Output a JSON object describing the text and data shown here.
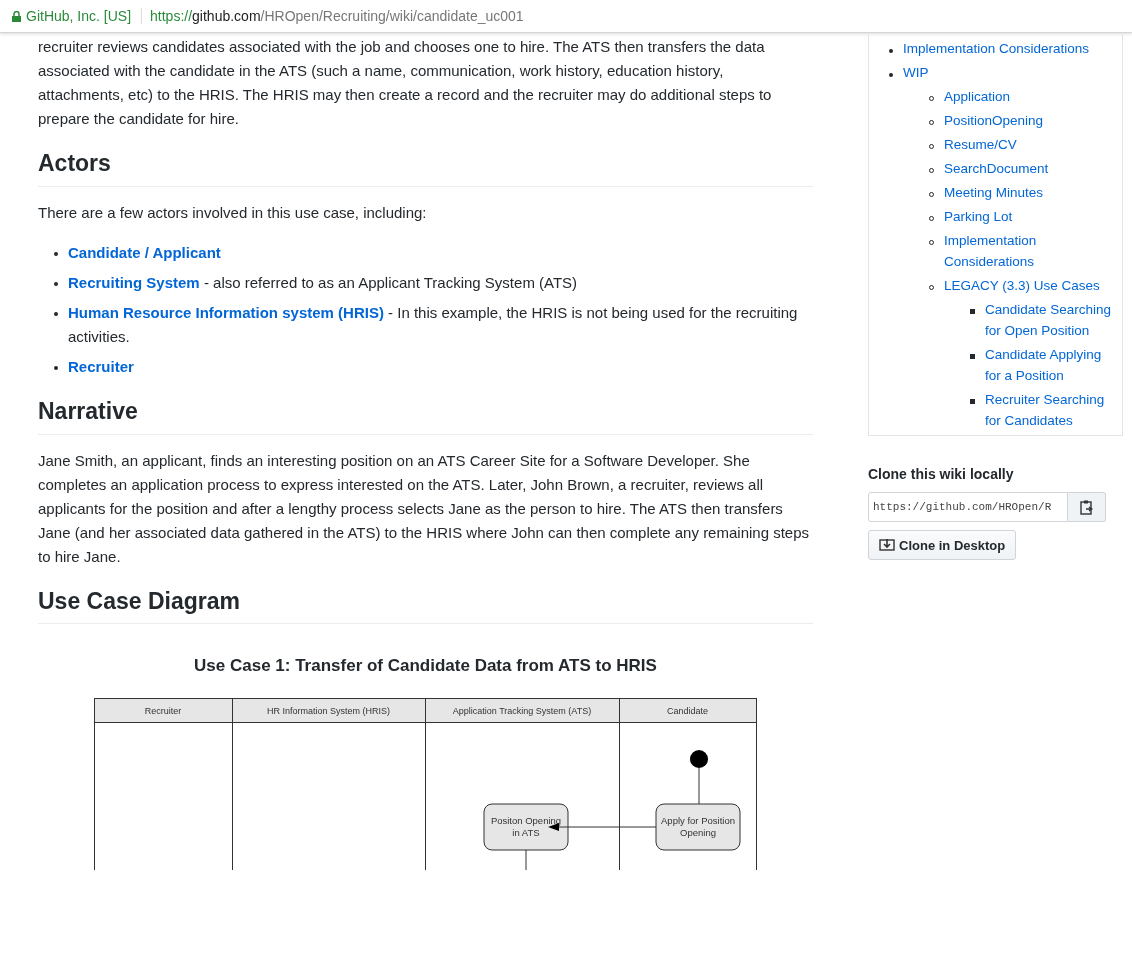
{
  "address_bar": {
    "site_identity": "GitHub, Inc. [US]",
    "url_scheme": "https://",
    "url_host": "github.com",
    "url_path": "/HROpen/Recruiting/wiki/candidate_uc001"
  },
  "article": {
    "intro": "recruiter reviews candidates associated with the job and chooses one to hire. The ATS then transfers the data associated with the candidate in the ATS (such a name, communication, work history, education history, attachments, etc) to the HRIS. The HRIS may then create a record and the recruiter may do additional steps to prepare the candidate for hire.",
    "actors_heading": "Actors",
    "actors_intro": "There are a few actors involved in this use case, including:",
    "actors": [
      {
        "link": "Candidate / Applicant"
      },
      {
        "link": "Recruiting System",
        "description": " - also referred to as an Applicant Tracking System (ATS)"
      },
      {
        "link": "Human Resource Information system (HRIS)",
        "description": " - In this example, the HRIS is not being used for the recruiting activities."
      },
      {
        "link": "Recruiter"
      }
    ],
    "narrative_heading": "Narrative",
    "narrative": "Jane Smith, an applicant, finds an interesting position on an ATS Career Site for a Software Developer. She completes an application process to express interested on the ATS. Later, John Brown, a recruiter, reviews all applicants for the position and after a lengthy process selects Jane as the person to hire. The ATS then transfers Jane (and her associated data gathered in the ATS) to the HRIS where John can then complete any remaining steps to hire Jane.",
    "diagram_heading": "Use Case Diagram",
    "diagram": {
      "title": "Use Case 1:  Transfer of Candidate Data from ATS to HRIS",
      "lanes": [
        "Recruiter",
        "HR Information System (HRIS)",
        "Application Tracking System (ATS)",
        "Candidate"
      ],
      "nodes": [
        {
          "kind": "start"
        },
        {
          "kind": "action",
          "lines": [
            "Positon Opening",
            "in ATS"
          ]
        },
        {
          "kind": "action",
          "lines": [
            "Apply for Position",
            "Opening"
          ]
        }
      ]
    }
  },
  "sidebar": {
    "pages": [
      {
        "label": "Implementation Considerations"
      },
      {
        "label": "WIP",
        "children": [
          {
            "label": "Application"
          },
          {
            "label": "PositionOpening"
          },
          {
            "label": "Resume/CV"
          },
          {
            "label": "SearchDocument"
          },
          {
            "label": "Meeting Minutes"
          },
          {
            "label": "Parking Lot"
          },
          {
            "label": "Implementation Considerations"
          },
          {
            "label": "LEGACY (3.3) Use Cases",
            "children": [
              {
                "label": "Candidate Searching for Open Position"
              },
              {
                "label": "Candidate Applying for a Position"
              },
              {
                "label": "Recruiter Searching for Candidates"
              }
            ]
          }
        ]
      }
    ],
    "clone_heading": "Clone this wiki locally",
    "clone_url": "https://github.com/HROpen/R",
    "clone_button": "Clone in Desktop"
  }
}
